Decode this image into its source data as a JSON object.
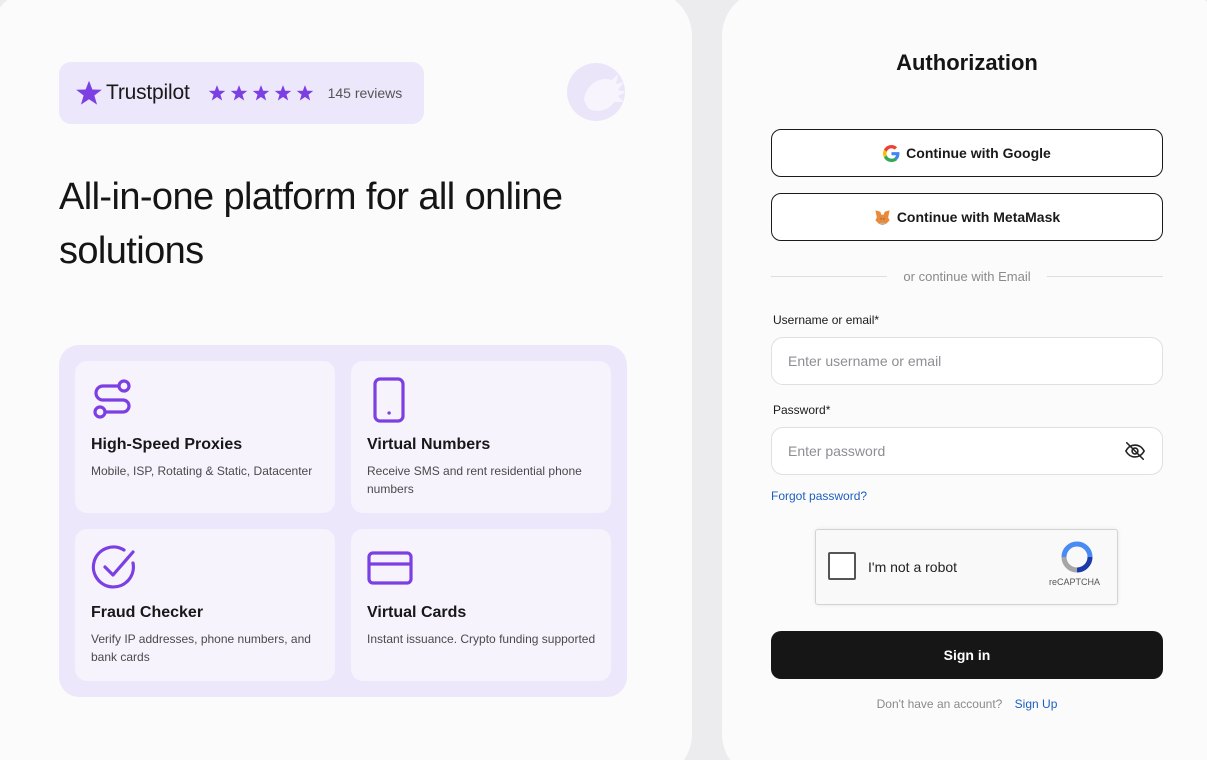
{
  "left": {
    "trustpilot": {
      "brand": "Trustpilot",
      "rating_stars": 5,
      "reviews": "145 reviews"
    },
    "headline": "All-in-one platform for all online solutions",
    "features": [
      {
        "icon": "route-icon",
        "title": "High-Speed Proxies",
        "description": "Mobile, ISP, Rotating & Static, Datacenter"
      },
      {
        "icon": "phone-icon",
        "title": "Virtual Numbers",
        "description": "Receive SMS and rent residential phone numbers"
      },
      {
        "icon": "check-circle-icon",
        "title": "Fraud Checker",
        "description": "Verify IP addresses, phone numbers, and bank cards"
      },
      {
        "icon": "credit-card-icon",
        "title": "Virtual Cards",
        "description": "Instant issuance. Crypto funding supported"
      }
    ]
  },
  "auth": {
    "title": "Authorization",
    "google_label": "Continue with Google",
    "metamask_label": "Continue with MetaMask",
    "divider": "or continue with Email",
    "username": {
      "label": "Username or email*",
      "placeholder": "Enter username or email",
      "value": ""
    },
    "password": {
      "label": "Password*",
      "placeholder": "Enter password",
      "value": ""
    },
    "forgot": "Forgot password?",
    "captcha": {
      "label": "I'm not a robot",
      "brand": "reCAPTCHA",
      "checked": false
    },
    "signin_label": "Sign in",
    "no_account": "Don't have an account?",
    "signup_label": "Sign Up"
  },
  "colors": {
    "accent_purple": "#7b3fe4",
    "card_bg": "#ede7fb",
    "primary_button": "#161616",
    "link": "#1d5fbf"
  }
}
